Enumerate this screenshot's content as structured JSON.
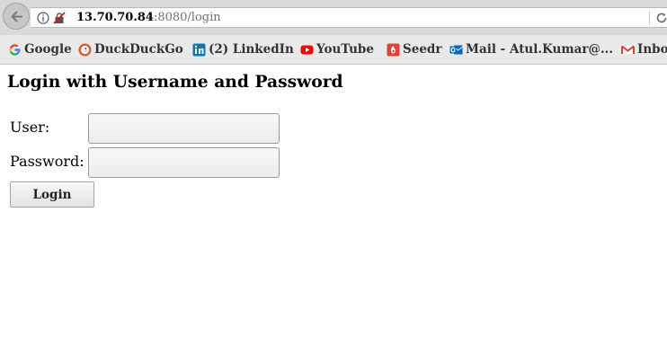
{
  "browser": {
    "url_host": "13.70.70.84",
    "url_rest": ":8080/login"
  },
  "bookmarks": [
    {
      "label": "Google",
      "icon": "google-icon"
    },
    {
      "label": "DuckDuckGo",
      "icon": "duckduckgo-icon"
    },
    {
      "label": "(2) LinkedIn",
      "icon": "linkedin-icon"
    },
    {
      "label": "YouTube",
      "icon": "youtube-icon"
    },
    {
      "label": "Seedr",
      "icon": "seedr-icon"
    },
    {
      "label": "Mail - Atul.Kumar@...",
      "icon": "outlook-icon"
    },
    {
      "label": "Inbo",
      "icon": "gmail-icon"
    }
  ],
  "page": {
    "title": "Login with Username and Password",
    "user_label": "User:",
    "user_value": "",
    "password_label": "Password:",
    "password_value": "",
    "login_button": "Login"
  }
}
